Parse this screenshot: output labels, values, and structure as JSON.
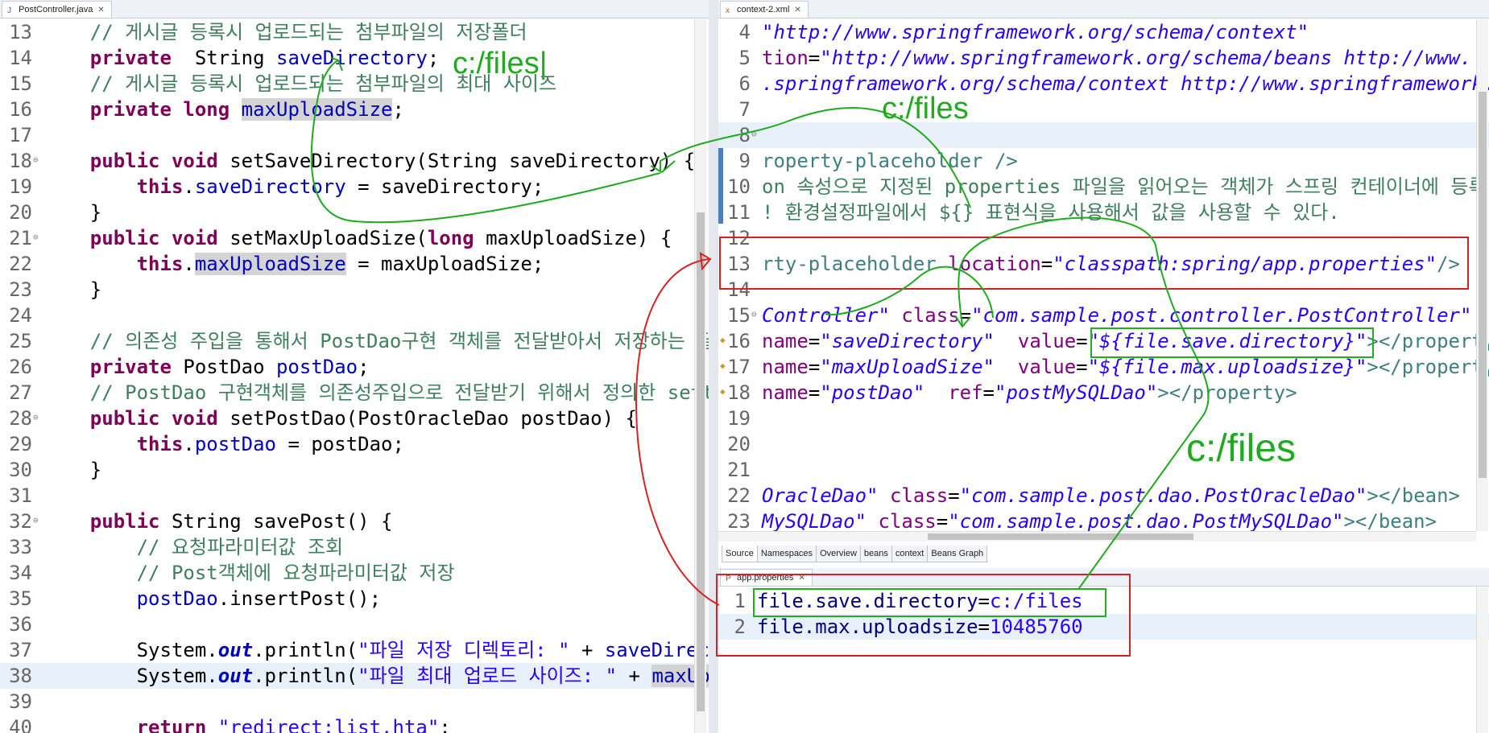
{
  "left_editor": {
    "tab": {
      "label": "PostController.java",
      "close": "✕"
    },
    "lines": [
      {
        "n": "13",
        "parts": [
          [
            "cm",
            "    // 게시글 등록시 업로드되는 첨부파일의 저장폴더"
          ]
        ]
      },
      {
        "n": "14",
        "parts": [
          [
            "kw",
            "    private"
          ],
          [
            "",
            "  String "
          ],
          [
            "fld",
            "saveDirectory"
          ],
          [
            "",
            ";"
          ]
        ]
      },
      {
        "n": "15",
        "parts": [
          [
            "cm",
            "    // 게시글 등록시 업로드되는 첨부파일의 최대 사이즈"
          ]
        ]
      },
      {
        "n": "16",
        "parts": [
          [
            "kw",
            "    private long "
          ],
          [
            "occfld",
            "maxUploadSize"
          ],
          [
            "",
            ";"
          ]
        ]
      },
      {
        "n": "17",
        "parts": [
          [
            "",
            ""
          ]
        ]
      },
      {
        "n": "18",
        "fold": "⊖",
        "parts": [
          [
            "kw",
            "    public void "
          ],
          [
            "",
            "setSaveDirectory(String saveDirectory) {"
          ]
        ]
      },
      {
        "n": "19",
        "parts": [
          [
            "kw",
            "        this"
          ],
          [
            "",
            "."
          ],
          [
            "fld",
            "saveDirectory"
          ],
          [
            "",
            " = saveDirectory;"
          ]
        ]
      },
      {
        "n": "20",
        "parts": [
          [
            "",
            "    }"
          ]
        ]
      },
      {
        "n": "21",
        "fold": "⊖",
        "parts": [
          [
            "kw",
            "    public void "
          ],
          [
            "",
            "setMaxUploadSize("
          ],
          [
            "kw",
            "long"
          ],
          [
            "",
            " maxUploadSize) {"
          ]
        ]
      },
      {
        "n": "22",
        "parts": [
          [
            "kw",
            "        this"
          ],
          [
            "",
            "."
          ],
          [
            "occfld",
            "maxUploadSize"
          ],
          [
            "",
            " = maxUploadSize;"
          ]
        ]
      },
      {
        "n": "23",
        "parts": [
          [
            "",
            "    }"
          ]
        ]
      },
      {
        "n": "24",
        "parts": [
          [
            "",
            ""
          ]
        ]
      },
      {
        "n": "25",
        "parts": [
          [
            "cm",
            "    // 의존성 주입을 통해서 PostDao구현 객체를 전달받아서 저장하는 필드"
          ]
        ]
      },
      {
        "n": "26",
        "parts": [
          [
            "kw",
            "    private "
          ],
          [
            "",
            "PostDao "
          ],
          [
            "fld",
            "postDao"
          ],
          [
            "",
            ";"
          ]
        ]
      },
      {
        "n": "27",
        "parts": [
          [
            "cm",
            "    // PostDao 구현객체를 의존성주입으로 전달받기 위해서 정의한 setter"
          ]
        ]
      },
      {
        "n": "28",
        "fold": "⊖",
        "parts": [
          [
            "kw",
            "    public void "
          ],
          [
            "",
            "setPostDao(PostOracleDao postDao) {"
          ]
        ]
      },
      {
        "n": "29",
        "parts": [
          [
            "kw",
            "        this"
          ],
          [
            "",
            "."
          ],
          [
            "fld",
            "postDao"
          ],
          [
            "",
            " = postDao;"
          ]
        ]
      },
      {
        "n": "30",
        "parts": [
          [
            "",
            "    }"
          ]
        ]
      },
      {
        "n": "31",
        "parts": [
          [
            "",
            ""
          ]
        ]
      },
      {
        "n": "32",
        "fold": "⊖",
        "parts": [
          [
            "kw",
            "    public "
          ],
          [
            "",
            "String savePost() {"
          ]
        ]
      },
      {
        "n": "33",
        "parts": [
          [
            "cm",
            "        // 요청파라미터값 조회"
          ]
        ]
      },
      {
        "n": "34",
        "parts": [
          [
            "cm",
            "        // Post객체에 요청파라미터값 저장"
          ]
        ]
      },
      {
        "n": "35",
        "parts": [
          [
            "fld",
            "        postDao"
          ],
          [
            "",
            ".insertPost();"
          ]
        ]
      },
      {
        "n": "36",
        "parts": [
          [
            "",
            ""
          ]
        ]
      },
      {
        "n": "37",
        "parts": [
          [
            "",
            "        System."
          ],
          [
            "sfld",
            "out"
          ],
          [
            "",
            ".println("
          ],
          [
            "st",
            "\"파일 저장 디렉토리: \""
          ],
          [
            "",
            " + "
          ],
          [
            "fld",
            "saveDirectory"
          ],
          [
            "",
            " );"
          ]
        ]
      },
      {
        "n": "38",
        "hl": true,
        "parts": [
          [
            "",
            "        System."
          ],
          [
            "sfld",
            "out"
          ],
          [
            "",
            ".println("
          ],
          [
            "st",
            "\"파일 최대 업로드 사이즈: \""
          ],
          [
            "",
            " + "
          ],
          [
            "occfld",
            "maxUploadSize"
          ],
          [
            "",
            " );"
          ]
        ]
      },
      {
        "n": "39",
        "parts": [
          [
            "",
            ""
          ]
        ]
      },
      {
        "n": "40",
        "parts": [
          [
            "kw",
            "        return "
          ],
          [
            "st",
            "\"redirect:list.hta\""
          ],
          [
            "",
            ";"
          ]
        ]
      }
    ]
  },
  "xml_editor": {
    "tab": {
      "label": "context-2.xml",
      "close": "✕"
    },
    "lines": [
      {
        "n": "4",
        "parts": [
          [
            "xv",
            "\"http://www.springframework.org/schema/context\""
          ]
        ]
      },
      {
        "n": "5",
        "parts": [
          [
            "attr",
            "tion"
          ],
          [
            "",
            "="
          ],
          [
            "xv",
            "\"http://www.springframework.org/schema/beans http://www."
          ]
        ]
      },
      {
        "n": "6",
        "parts": [
          [
            "xv",
            ".springframework.org/schema/context http://www.springframework."
          ]
        ]
      },
      {
        "n": "7",
        "parts": [
          [
            "",
            ""
          ]
        ]
      },
      {
        "n": "8",
        "fold": "⊖",
        "hl": true,
        "parts": [
          [
            "",
            ""
          ]
        ]
      },
      {
        "n": "9",
        "parts": [
          [
            "tag",
            "roperty-placeholder />"
          ]
        ]
      },
      {
        "n": "10",
        "parts": [
          [
            "cm",
            "on 속성으로 지정된 properties 파일을 읽어오는 객체가 스프링 컨테이너에 등록"
          ]
        ]
      },
      {
        "n": "11",
        "parts": [
          [
            "cm",
            "! 환경설정파일에서 ${} 표현식을 사용해서 값을 사용할 수 있다."
          ]
        ]
      },
      {
        "n": "12",
        "parts": [
          [
            "",
            ""
          ]
        ]
      },
      {
        "n": "13",
        "parts": [
          [
            "tag",
            "rty-placeholder "
          ],
          [
            "attr",
            "location"
          ],
          [
            "",
            "="
          ],
          [
            "xv",
            "\"classpath:spring/app.properties\""
          ],
          [
            "tag",
            "/>"
          ]
        ]
      },
      {
        "n": "14",
        "parts": [
          [
            "",
            ""
          ]
        ]
      },
      {
        "n": "15",
        "fold": "⊖",
        "parts": [
          [
            "xv",
            "Controller\" "
          ],
          [
            "attr",
            "class"
          ],
          [
            "",
            "="
          ],
          [
            "xv",
            "\"com.sample.post.controller.PostController\""
          ]
        ]
      },
      {
        "n": "16",
        "mark": "◆",
        "parts": [
          [
            "attr",
            "name"
          ],
          [
            "",
            "="
          ],
          [
            "xv",
            "\"saveDirectory\""
          ],
          [
            "attr",
            "  value"
          ],
          [
            "",
            "="
          ],
          [
            "xv",
            "\"${file.save.directory}\""
          ],
          [
            "tag",
            "></property>"
          ]
        ]
      },
      {
        "n": "17",
        "mark": "◆",
        "parts": [
          [
            "attr",
            "name"
          ],
          [
            "",
            "="
          ],
          [
            "xv",
            "\"maxUploadSize\""
          ],
          [
            "attr",
            "  value"
          ],
          [
            "",
            "="
          ],
          [
            "xv",
            "\"${file.max.uploadsize}\""
          ],
          [
            "tag",
            "></property>"
          ]
        ]
      },
      {
        "n": "18",
        "mark": "◆",
        "parts": [
          [
            "attr",
            "name"
          ],
          [
            "",
            "="
          ],
          [
            "xv",
            "\"postDao\""
          ],
          [
            "attr",
            "  ref"
          ],
          [
            "",
            "="
          ],
          [
            "xv",
            "\"postMySQLDao\""
          ],
          [
            "tag",
            "></property>"
          ]
        ]
      },
      {
        "n": "19",
        "parts": [
          [
            "",
            ""
          ]
        ]
      },
      {
        "n": "20",
        "parts": [
          [
            "",
            ""
          ]
        ]
      },
      {
        "n": "21",
        "parts": [
          [
            "",
            ""
          ]
        ]
      },
      {
        "n": "22",
        "parts": [
          [
            "xv",
            "OracleDao\" "
          ],
          [
            "attr",
            "class"
          ],
          [
            "",
            "="
          ],
          [
            "xv",
            "\"com.sample.post.dao.PostOracleDao\""
          ],
          [
            "tag",
            "></bean>"
          ]
        ]
      },
      {
        "n": "23",
        "parts": [
          [
            "xv",
            "MySQLDao\" "
          ],
          [
            "attr",
            "class"
          ],
          [
            "",
            "="
          ],
          [
            "xv",
            "\"com.sample.post.dao.PostMySQLDao\""
          ],
          [
            "tag",
            "></bean>"
          ]
        ]
      }
    ],
    "bottom_tabs": [
      "Source",
      "Namespaces",
      "Overview",
      "beans",
      "context",
      "Beans Graph"
    ]
  },
  "props_editor": {
    "tab": {
      "label": "app.properties",
      "close": "✕"
    },
    "lines": [
      {
        "n": "1",
        "key": "file.save.directory",
        "val": "c:/files"
      },
      {
        "n": "2",
        "key": "file.max.uploadsize",
        "val": "10485760",
        "hl": true
      }
    ]
  },
  "annotations": {
    "note1": "c:/files|",
    "note2": "c:/files",
    "note3": "c:/files"
  },
  "colors": {
    "annotation_green": "#1faa1f",
    "annotation_red": "#d82222"
  }
}
